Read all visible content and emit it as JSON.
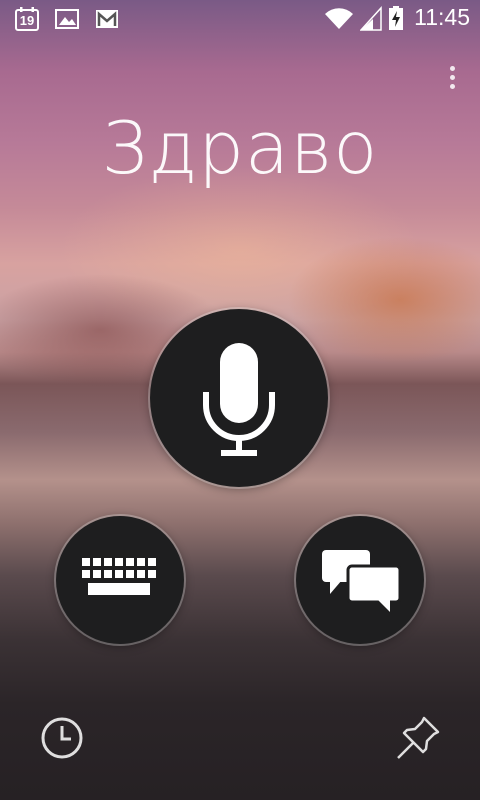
{
  "status_bar": {
    "calendar_day": "19",
    "time": "11:45",
    "icons": [
      "calendar-icon",
      "image-icon",
      "gmail-icon",
      "wifi-icon",
      "signal-icon",
      "battery-charging-icon"
    ]
  },
  "main": {
    "greeting": "Здраво"
  },
  "buttons": {
    "microphone": "microphone-icon",
    "keyboard": "keyboard-icon",
    "conversation": "chat-bubbles-icon",
    "history": "clock-icon",
    "pin": "pin-icon",
    "menu": "overflow-menu-icon"
  },
  "colors": {
    "button_fill": "#1e1e1f",
    "icon": "#ffffff"
  }
}
